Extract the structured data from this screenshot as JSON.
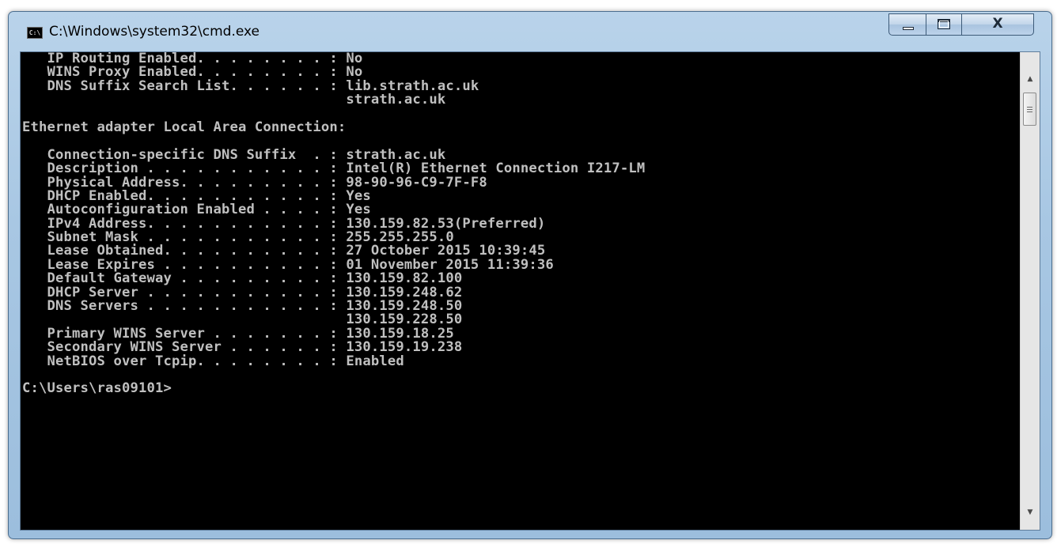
{
  "window": {
    "title": "C:\\Windows\\system32\\cmd.exe",
    "app_icon_text": "C:\\",
    "close_glyph": "X"
  },
  "console": {
    "lines": [
      "   IP Routing Enabled. . . . . . . . : No",
      "   WINS Proxy Enabled. . . . . . . . : No",
      "   DNS Suffix Search List. . . . . . : lib.strath.ac.uk",
      "                                       strath.ac.uk",
      "",
      "Ethernet adapter Local Area Connection:",
      "",
      "   Connection-specific DNS Suffix  . : strath.ac.uk",
      "   Description . . . . . . . . . . . : Intel(R) Ethernet Connection I217-LM",
      "   Physical Address. . . . . . . . . : 98-90-96-C9-7F-F8",
      "   DHCP Enabled. . . . . . . . . . . : Yes",
      "   Autoconfiguration Enabled . . . . : Yes",
      "   IPv4 Address. . . . . . . . . . . : 130.159.82.53(Preferred)",
      "   Subnet Mask . . . . . . . . . . . : 255.255.255.0",
      "   Lease Obtained. . . . . . . . . . : 27 October 2015 10:39:45",
      "   Lease Expires . . . . . . . . . . : 01 November 2015 11:39:36",
      "   Default Gateway . . . . . . . . . : 130.159.82.100",
      "   DHCP Server . . . . . . . . . . . : 130.159.248.62",
      "   DNS Servers . . . . . . . . . . . : 130.159.248.50",
      "                                       130.159.228.50",
      "   Primary WINS Server . . . . . . . : 130.159.18.25",
      "   Secondary WINS Server . . . . . . : 130.159.19.238",
      "   NetBIOS over Tcpip. . . . . . . . : Enabled",
      "",
      "C:\\Users\\ras09101>"
    ]
  },
  "scrollbar": {
    "up_arrow": "▲",
    "down_arrow": "▼"
  },
  "colors": {
    "console_background": "#000000",
    "console_text": "#c0c0c0",
    "frame": "#a8c7e3"
  }
}
